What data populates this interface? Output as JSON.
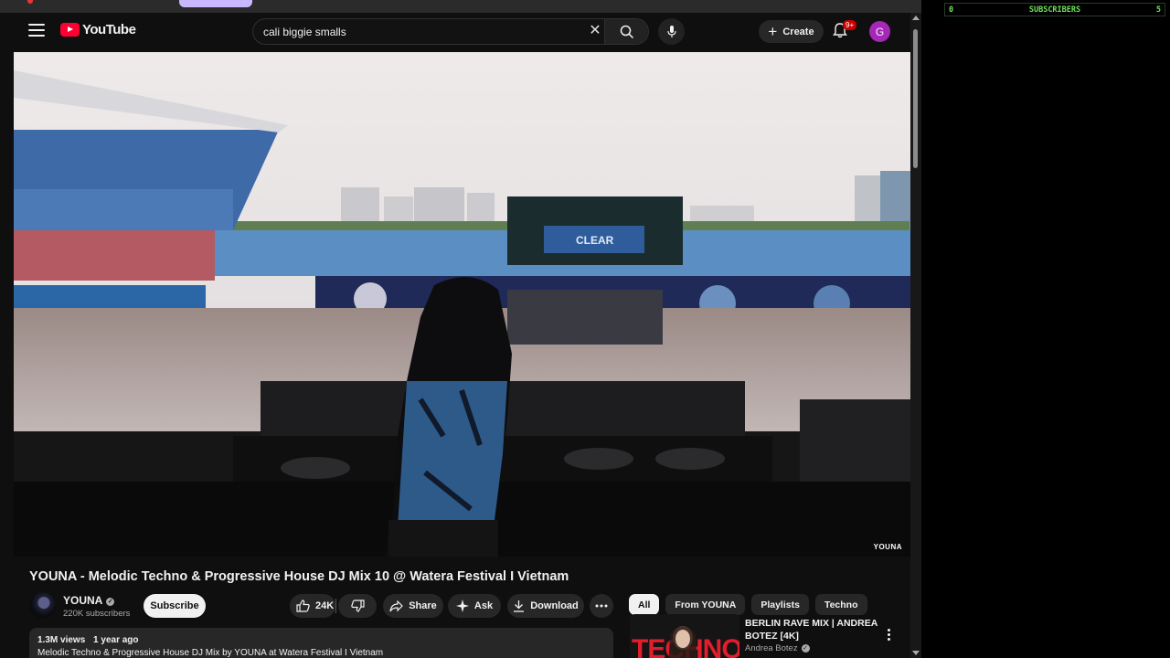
{
  "header": {
    "logo_text": "YouTube",
    "search_value": "cali biggie smalls",
    "search_placeholder": "Search",
    "create_label": "Create",
    "notification_count": "9+",
    "avatar_letter": "G"
  },
  "video": {
    "watermark": "YOUNA",
    "title": "YOUNA - Melodic Techno & Progressive House DJ Mix 10 @ Watera Festival I Vietnam",
    "screen_text": "CLEAR"
  },
  "channel": {
    "name": "YOUNA",
    "subscribers": "220K subscribers",
    "subscribe_label": "Subscribe"
  },
  "actions": {
    "likes": "24K",
    "share_label": "Share",
    "ask_label": "Ask",
    "download_label": "Download"
  },
  "description": {
    "views": "1.3M views",
    "age": "1 year ago",
    "text": "Melodic Techno & Progressive House DJ Mix by YOUNA at  Watera Festival I Vietnam"
  },
  "chips": [
    "All",
    "From YOUNA",
    "Playlists",
    "Techno"
  ],
  "recommendations": [
    {
      "title": "BERLIN RAVE MIX | ANDREA BOTEZ [4K]",
      "channel": "Andrea Botez",
      "thumb_text": "TECHNO"
    }
  ],
  "side_widget": {
    "left_value": "0",
    "label": "SUBSCRIBERS",
    "right_value": "5"
  },
  "colors": {
    "background": "#0f0f0f",
    "brand_red": "#ff0033",
    "avatar": "#a727b8",
    "widget_green": "#6fe35b"
  }
}
